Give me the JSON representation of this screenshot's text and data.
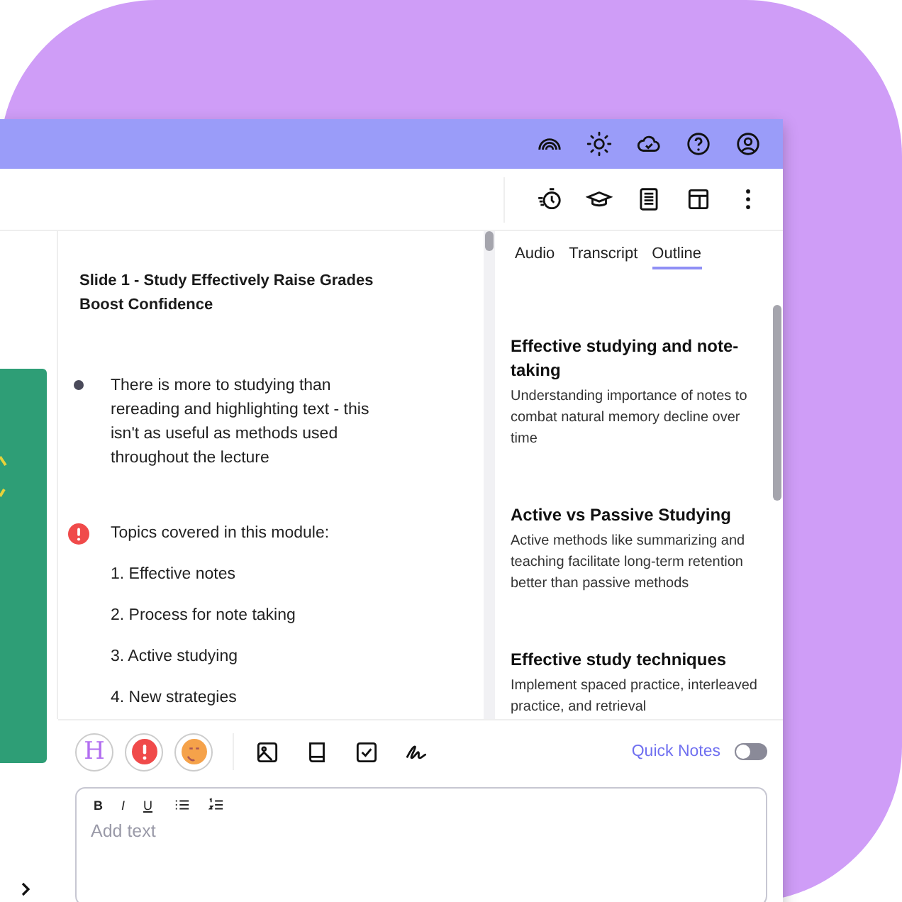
{
  "notes": {
    "title": "Slide 1 - Study Effectively Raise Grades Boost Confidence",
    "items": [
      {
        "kind": "bullet",
        "text": "There is more to studying than rereading and highlighting text - this isn't as useful as methods used throughout the lecture"
      },
      {
        "kind": "alert",
        "text": "Topics covered in this module:",
        "subitems": [
          "1. Effective notes",
          "2. Process for note taking",
          "3. Active studying",
          "4. New strategies"
        ]
      }
    ]
  },
  "tabs": [
    {
      "label": "Audio",
      "selected": false
    },
    {
      "label": "Transcript",
      "selected": false
    },
    {
      "label": "Outline",
      "selected": true
    }
  ],
  "outline": [
    {
      "title": "Effective studying and note-taking",
      "text": "Understanding importance of notes to combat natural memory decline over time"
    },
    {
      "title": "Active vs Passive Studying",
      "text": "Active methods like summarizing and teaching facilitate long-term retention better than passive methods"
    },
    {
      "title": "Effective study techniques",
      "text": "Implement spaced practice, interleaved practice, and retrieval"
    }
  ],
  "note_tools": {
    "heading_label": "H",
    "quick_notes": {
      "label": "Quick Notes",
      "on": false
    }
  },
  "editor": {
    "placeholder": "Add text",
    "format_buttons": [
      "B",
      "I",
      "U"
    ]
  }
}
